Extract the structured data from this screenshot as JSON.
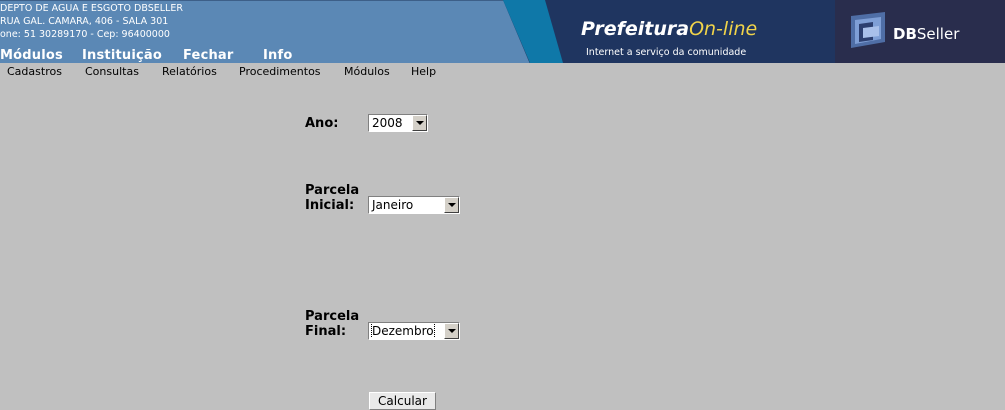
{
  "header": {
    "org_name": "DEPTO DE AGUA E ESGOTO DBSELLER",
    "address": "RUA GAL. CAMARA, 406 - SALA 301",
    "contact": "one: 51 30289170  -  Cep: 96400000",
    "menu": [
      "Módulos",
      "Instituição",
      "Fechar",
      "Info"
    ],
    "banner": {
      "title_part1": "Prefeitura",
      "title_part2": "On-line",
      "subtitle": "Internet a serviço da comunidade",
      "accent_color": "#f1d44a"
    },
    "logo": {
      "brand_bold": "DB",
      "brand_rest": "Seller"
    }
  },
  "submenu": [
    "Cadastros",
    "Consultas",
    "Relatórios",
    "Procedimentos",
    "Módulos",
    "Help"
  ],
  "form": {
    "ano": {
      "label": "Ano:",
      "value": "2008"
    },
    "parcela_inicial": {
      "label_line1": "Parcela",
      "label_line2": "Inicial:",
      "value": "Janeiro"
    },
    "parcela_final": {
      "label_line1": "Parcela",
      "label_line2": "Final:",
      "value": "Dezembro"
    },
    "submit_label": "Calcular"
  },
  "colors": {
    "header_bg": "#5b88b5",
    "page_bg": "#c0c0c0",
    "banner_bg": "#1f3560",
    "logo_bg": "#292d4d"
  }
}
